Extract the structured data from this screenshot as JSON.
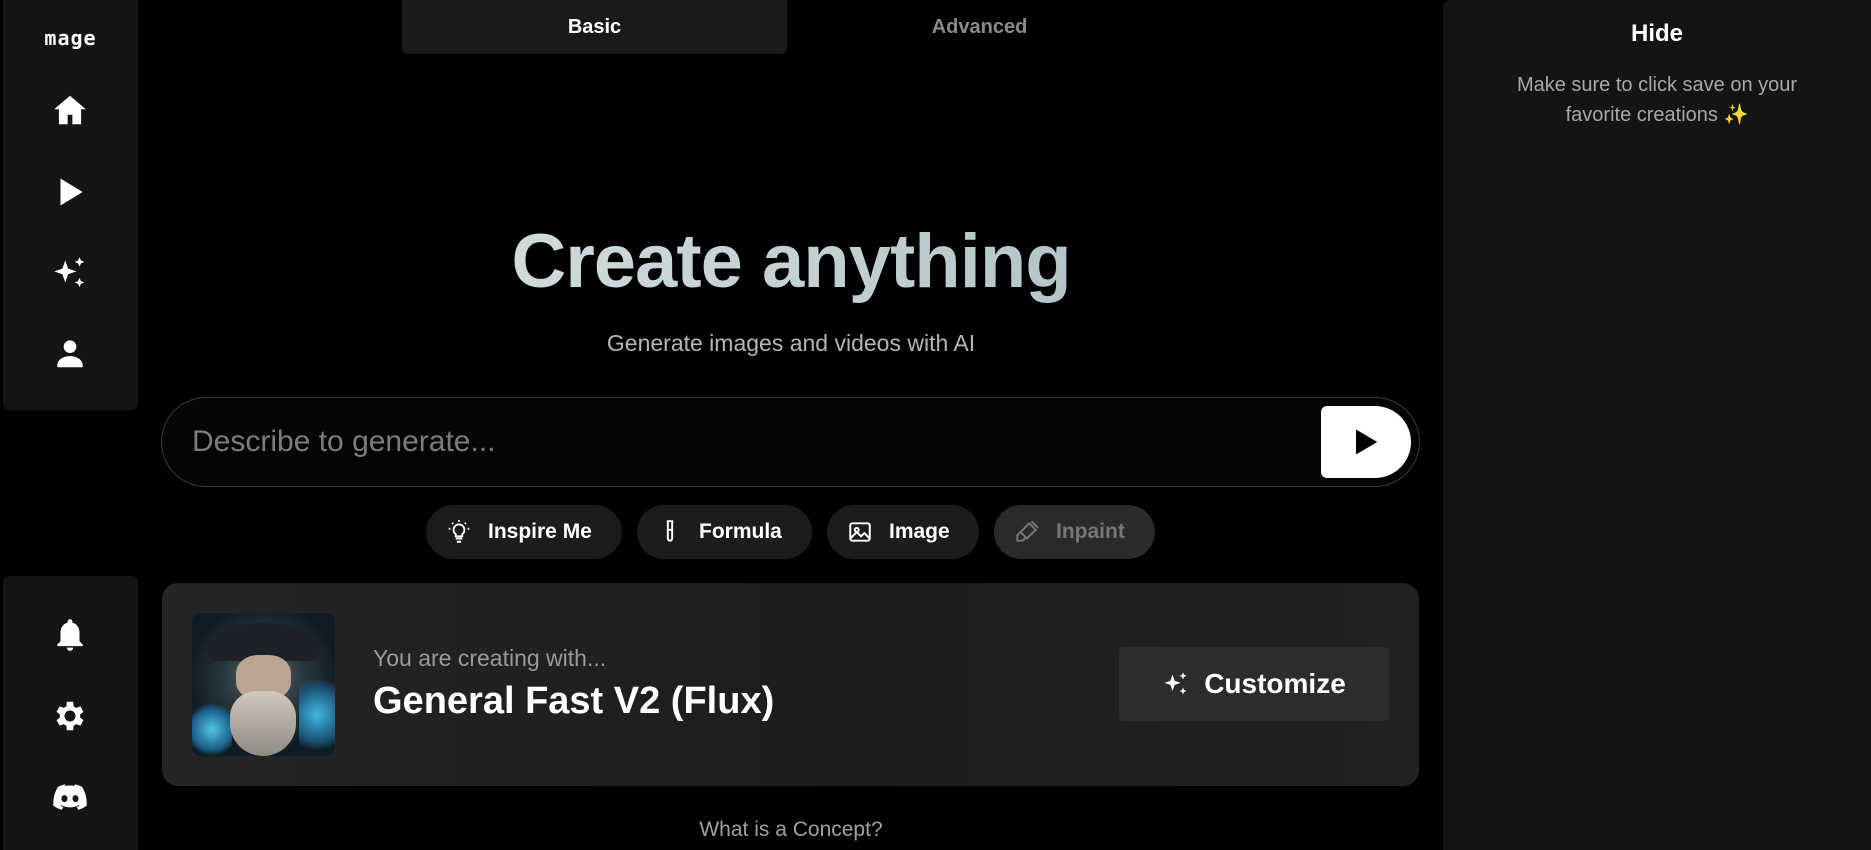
{
  "sidebar": {
    "logo": "mage",
    "top_items": [
      {
        "name": "home",
        "icon": "home-icon"
      },
      {
        "name": "play",
        "icon": "play-icon"
      },
      {
        "name": "create",
        "icon": "sparkles-icon"
      },
      {
        "name": "profile",
        "icon": "user-icon"
      }
    ],
    "bottom_items": [
      {
        "name": "notifications",
        "icon": "bell-icon"
      },
      {
        "name": "settings",
        "icon": "gear-icon"
      },
      {
        "name": "discord",
        "icon": "discord-icon"
      }
    ]
  },
  "tabs": [
    {
      "label": "Basic",
      "active": true
    },
    {
      "label": "Advanced",
      "active": false
    }
  ],
  "hero": {
    "title": "Create anything",
    "subtitle": "Generate images and videos with AI"
  },
  "prompt": {
    "placeholder": "Describe to generate...",
    "value": ""
  },
  "chips": [
    {
      "label": "Inspire Me",
      "icon": "lightbulb-icon",
      "enabled": true
    },
    {
      "label": "Formula",
      "icon": "test-tube-icon",
      "enabled": true
    },
    {
      "label": "Image",
      "icon": "image-icon",
      "enabled": true
    },
    {
      "label": "Inpaint",
      "icon": "brush-icon",
      "enabled": false
    }
  ],
  "model_card": {
    "caption": "You are creating with...",
    "model_name": "General Fast V2 (Flux)",
    "customize_label": "Customize"
  },
  "footer_link": "What is a Concept?",
  "right_panel": {
    "hide_label": "Hide",
    "message": "Make sure to click save on your favorite creations ✨"
  },
  "colors": {
    "background": "#000000",
    "panel": "#151515",
    "accent_gradient_start": "#dfe3e0",
    "accent_gradient_end": "#9fb6bb"
  }
}
